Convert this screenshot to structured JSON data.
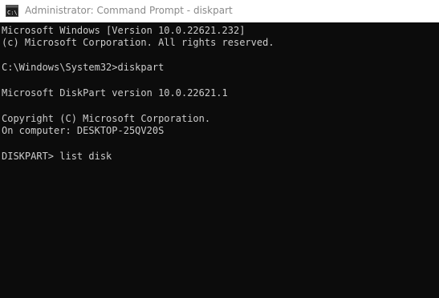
{
  "window": {
    "title": "Administrator: Command Prompt - diskpart",
    "icon": "cmd-prompt-icon",
    "colors": {
      "background": "#0c0c0c",
      "text": "#cccccc",
      "titlebar": "#ffffff",
      "title_text": "#8a8a8a"
    }
  },
  "console": {
    "lines": [
      "Microsoft Windows [Version 10.0.22621.232]",
      "(c) Microsoft Corporation. All rights reserved.",
      "",
      "C:\\Windows\\System32>diskpart",
      "",
      "Microsoft DiskPart version 10.0.22621.1",
      "",
      "Copyright (C) Microsoft Corporation.",
      "On computer: DESKTOP-25QV20S",
      "",
      "DISKPART> list disk"
    ]
  }
}
